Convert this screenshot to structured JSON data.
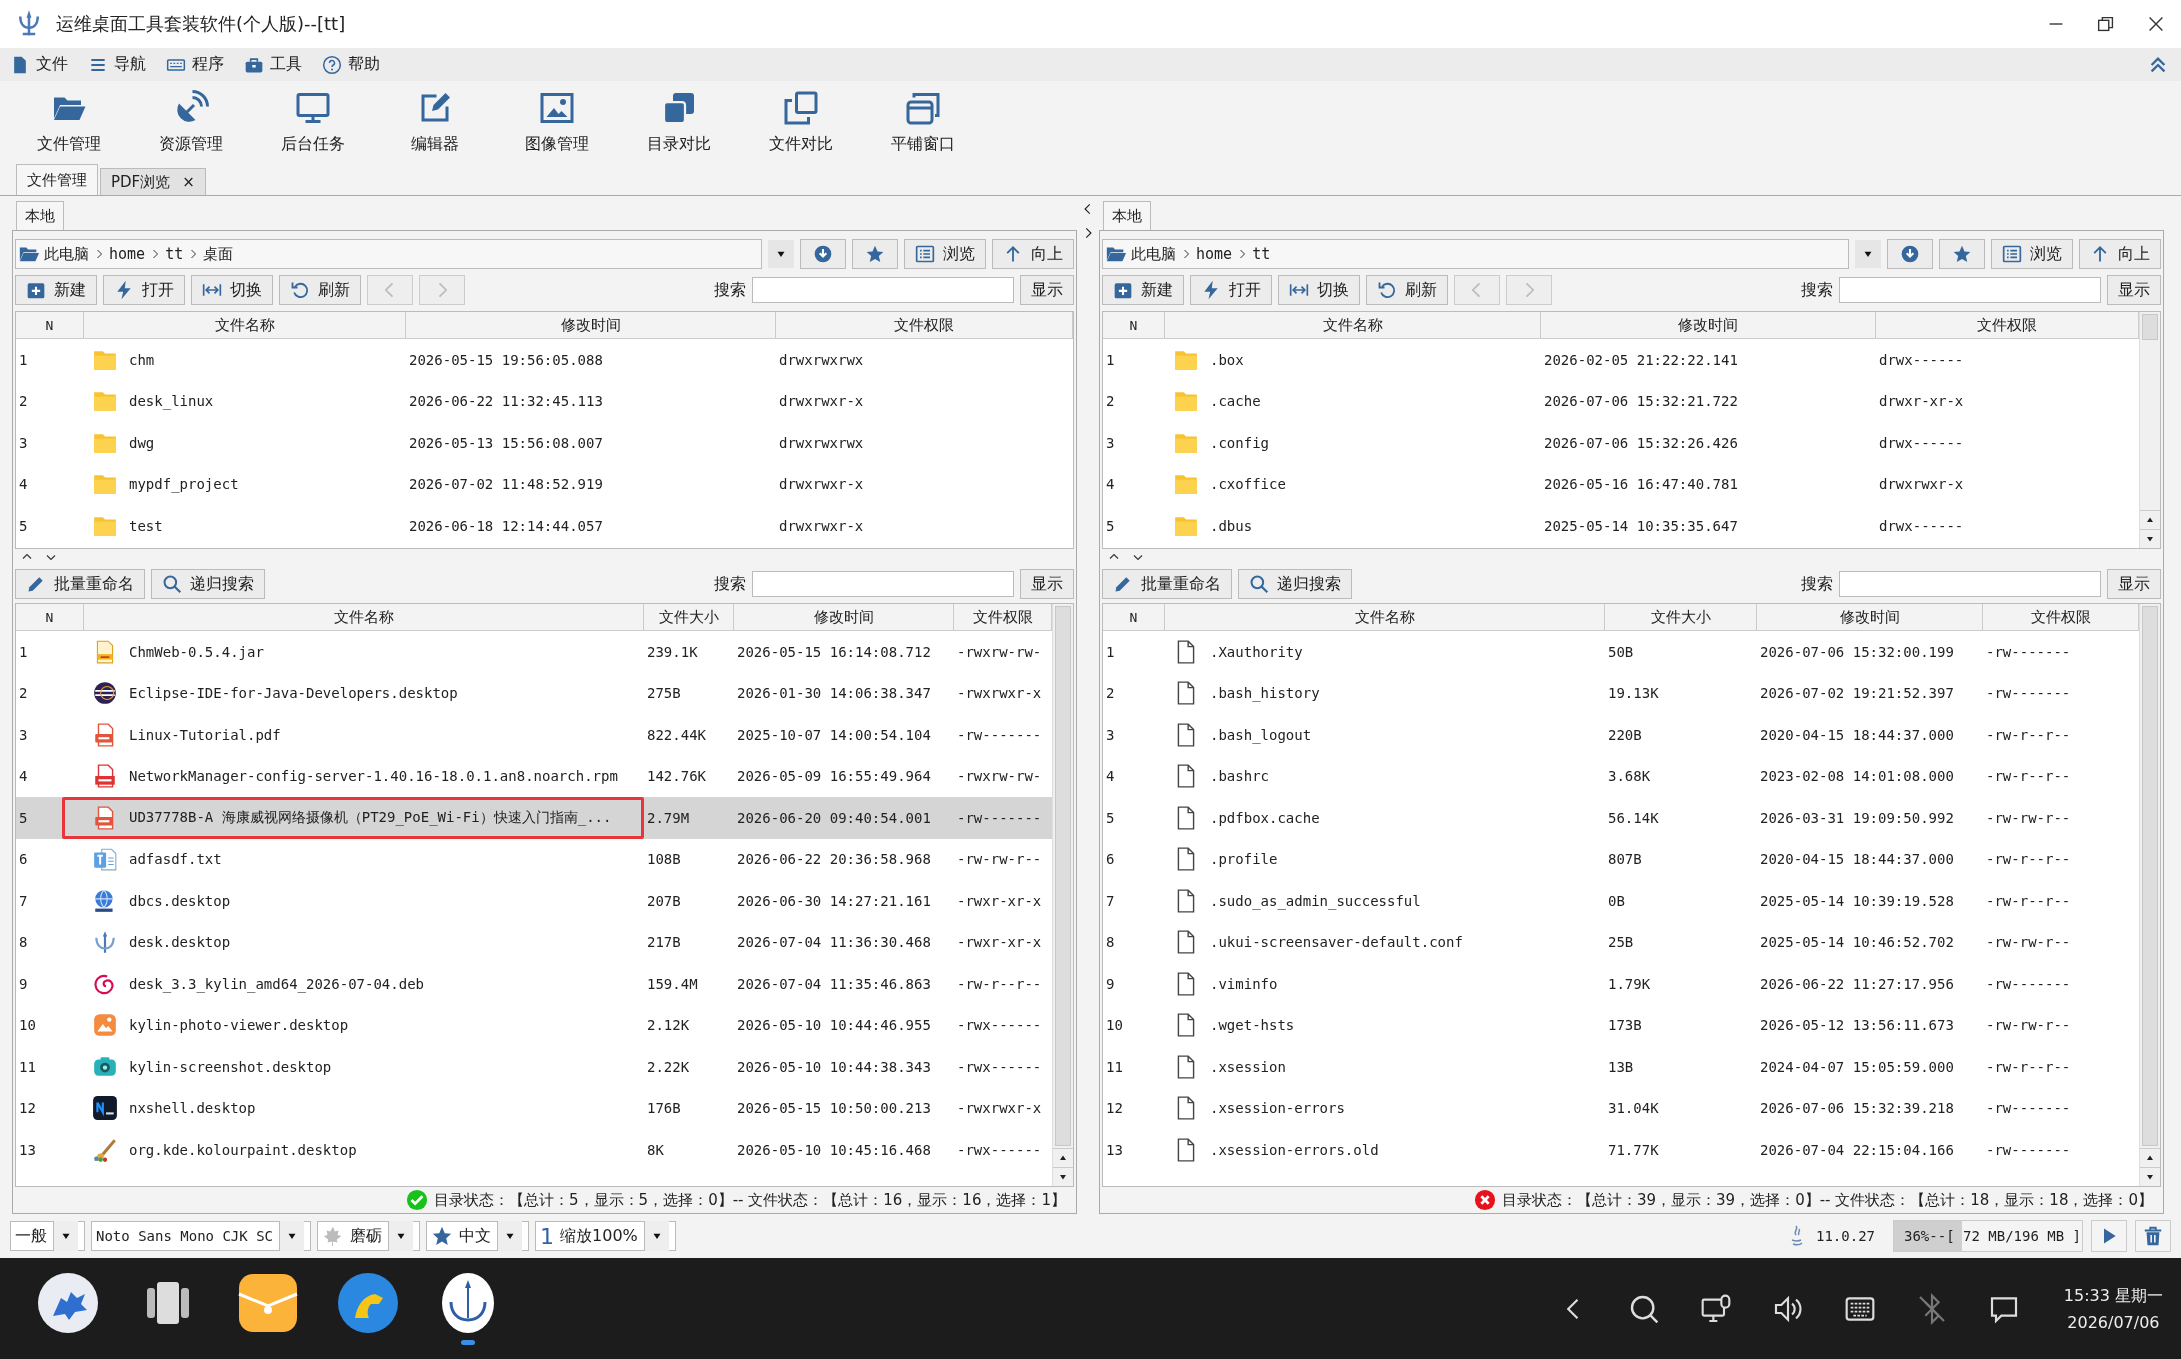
{
  "window": {
    "title": "运维桌面工具套装软件(个人版)--[tt]"
  },
  "menu": [
    {
      "label": "文件"
    },
    {
      "label": "导航"
    },
    {
      "label": "程序"
    },
    {
      "label": "工具"
    },
    {
      "label": "帮助"
    }
  ],
  "toolbar": [
    {
      "label": "文件管理"
    },
    {
      "label": "资源管理"
    },
    {
      "label": "后台任务"
    },
    {
      "label": "编辑器"
    },
    {
      "label": "图像管理"
    },
    {
      "label": "目录对比"
    },
    {
      "label": "文件对比"
    },
    {
      "label": "平铺窗口"
    }
  ],
  "tabs": [
    {
      "label": "文件管理",
      "selected": true
    },
    {
      "label": "PDF浏览",
      "selected": false,
      "close": "×"
    }
  ],
  "panels": [
    {
      "tab": "本地",
      "path": [
        "此电脑",
        "home",
        "tt",
        "桌面"
      ],
      "path_buttons": [
        "浏览",
        "向上"
      ],
      "actions": [
        "新建",
        "打开",
        "切换",
        "刷新"
      ],
      "nav": [
        {
          "disabled": true
        },
        {
          "disabled": true
        }
      ],
      "search_label": "搜索",
      "show_button": "显示",
      "dirs": {
        "columns": [
          "N",
          "文件名称",
          "修改时间",
          "文件权限"
        ],
        "rows": [
          {
            "n": "1",
            "name": "chm",
            "modified": "2026-05-15 19:56:05.088",
            "perm": "drwxrwxrwx"
          },
          {
            "n": "2",
            "name": "desk_linux",
            "modified": "2026-06-22 11:32:45.113",
            "perm": "drwxrwxr-x"
          },
          {
            "n": "3",
            "name": "dwg",
            "modified": "2026-05-13 15:56:08.007",
            "perm": "drwxrwxrwx"
          },
          {
            "n": "4",
            "name": "mypdf_project",
            "modified": "2026-07-02 11:48:52.919",
            "perm": "drwxrwxr-x"
          },
          {
            "n": "5",
            "name": "test",
            "modified": "2026-06-18 12:14:44.057",
            "perm": "drwxrwxr-x"
          }
        ]
      },
      "file_actions": [
        "批量重命名",
        "递归搜索"
      ],
      "file_search_label": "搜索",
      "file_show_button": "显示",
      "files": {
        "columns": [
          "N",
          "文件名称",
          "文件大小",
          "修改时间",
          "文件权限"
        ],
        "rows": [
          {
            "n": "1",
            "kind": "jar",
            "name": "ChmWeb-0.5.4.jar",
            "size": "239.1K",
            "modified": "2026-05-15 16:14:08.712",
            "perm": "-rwxrw-rw-",
            "selected": false,
            "outlined": false
          },
          {
            "n": "2",
            "kind": "app",
            "name": "Eclipse-IDE-for-Java-Developers.desktop",
            "size": "275B",
            "modified": "2026-01-30 14:06:38.347",
            "perm": "-rwxrwxr-x",
            "selected": false,
            "outlined": false
          },
          {
            "n": "3",
            "kind": "pdf",
            "name": "Linux-Tutorial.pdf",
            "size": "822.44K",
            "modified": "2025-10-07 14:00:54.104",
            "perm": "-rw-------",
            "selected": false,
            "outlined": false
          },
          {
            "n": "4",
            "kind": "rpm",
            "name": "NetworkManager-config-server-1.40.16-18.0.1.an8.noarch.rpm",
            "size": "142.76K",
            "modified": "2026-05-09 16:55:49.964",
            "perm": "-rwxrw-rw-",
            "selected": false,
            "outlined": false
          },
          {
            "n": "5",
            "kind": "pdf",
            "name": "UD37778B-A 海康威视网络摄像机（PT29_PoE_Wi-Fi）快速入门指南_...",
            "size": "2.79M",
            "modified": "2026-06-20 09:40:54.001",
            "perm": "-rw-------",
            "selected": true,
            "outlined": true
          },
          {
            "n": "6",
            "kind": "text",
            "name": "adfasdf.txt",
            "size": "108B",
            "modified": "2026-06-22 20:36:58.968",
            "perm": "-rw-rw-r--",
            "selected": false,
            "outlined": false
          },
          {
            "n": "7",
            "kind": "globe",
            "name": "dbcs.desktop",
            "size": "207B",
            "modified": "2026-06-30 14:27:21.161",
            "perm": "-rwxr-xr-x",
            "selected": false,
            "outlined": false
          },
          {
            "n": "8",
            "kind": "logo",
            "name": "desk.desktop",
            "size": "217B",
            "modified": "2026-07-04 11:36:30.468",
            "perm": "-rwxr-xr-x",
            "selected": false,
            "outlined": false
          },
          {
            "n": "9",
            "kind": "deb",
            "name": "desk_3.3_kylin_amd64_2026-07-04.deb",
            "size": "159.4M",
            "modified": "2026-07-04 11:35:46.863",
            "perm": "-rw-r--r--",
            "selected": false,
            "outlined": false
          },
          {
            "n": "10",
            "kind": "photo",
            "name": "kylin-photo-viewer.desktop",
            "size": "2.12K",
            "modified": "2026-05-10 10:44:46.955",
            "perm": "-rwx------",
            "selected": false,
            "outlined": false
          },
          {
            "n": "11",
            "kind": "camera",
            "name": "kylin-screenshot.desktop",
            "size": "2.22K",
            "modified": "2026-05-10 10:44:38.343",
            "perm": "-rwx------",
            "selected": false,
            "outlined": false
          },
          {
            "n": "12",
            "kind": "terminal",
            "name": "nxshell.desktop",
            "size": "176B",
            "modified": "2026-05-15 10:50:00.213",
            "perm": "-rwxrwxr-x",
            "selected": false,
            "outlined": false
          },
          {
            "n": "13",
            "kind": "paint",
            "name": "org.kde.kolourpaint.desktop",
            "size": "8K",
            "modified": "2026-05-10 10:45:16.468",
            "perm": "-rwx------",
            "selected": false,
            "outlined": false
          }
        ]
      },
      "status": {
        "ok": true,
        "text": "目录状态：【总计：5，显示：5，选择：0】-- 文件状态：【总计：16，显示：16，选择：1】"
      }
    },
    {
      "tab": "本地",
      "path": [
        "此电脑",
        "home",
        "tt"
      ],
      "path_buttons": [
        "浏览",
        "向上"
      ],
      "actions": [
        "新建",
        "打开",
        "切换",
        "刷新"
      ],
      "nav": [
        {
          "disabled": true
        },
        {
          "disabled": true
        }
      ],
      "search_label": "搜索",
      "show_button": "显示",
      "dirs": {
        "columns": [
          "N",
          "文件名称",
          "修改时间",
          "文件权限"
        ],
        "rows": [
          {
            "n": "1",
            "name": ".box",
            "modified": "2026-02-05 21:22:22.141",
            "perm": "drwx------"
          },
          {
            "n": "2",
            "name": ".cache",
            "modified": "2026-07-06 15:32:21.722",
            "perm": "drwxr-xr-x"
          },
          {
            "n": "3",
            "name": ".config",
            "modified": "2026-07-06 15:32:26.426",
            "perm": "drwx------"
          },
          {
            "n": "4",
            "name": ".cxoffice",
            "modified": "2026-05-16 16:47:40.781",
            "perm": "drwxrwxr-x"
          },
          {
            "n": "5",
            "name": ".dbus",
            "modified": "2025-05-14 10:35:35.647",
            "perm": "drwx------"
          }
        ]
      },
      "file_actions": [
        "批量重命名",
        "递归搜索"
      ],
      "file_search_label": "搜索",
      "file_show_button": "显示",
      "files": {
        "columns": [
          "N",
          "文件名称",
          "文件大小",
          "修改时间",
          "文件权限"
        ],
        "rows": [
          {
            "n": "1",
            "kind": "doc",
            "name": ".Xauthority",
            "size": "50B",
            "modified": "2026-07-06 15:32:00.199",
            "perm": "-rw-------",
            "selected": false,
            "outlined": false
          },
          {
            "n": "2",
            "kind": "doc",
            "name": ".bash_history",
            "size": "19.13K",
            "modified": "2026-07-02 19:21:52.397",
            "perm": "-rw-------",
            "selected": false,
            "outlined": false
          },
          {
            "n": "3",
            "kind": "doc",
            "name": ".bash_logout",
            "size": "220B",
            "modified": "2020-04-15 18:44:37.000",
            "perm": "-rw-r--r--",
            "selected": false,
            "outlined": false
          },
          {
            "n": "4",
            "kind": "doc",
            "name": ".bashrc",
            "size": "3.68K",
            "modified": "2023-02-08 14:01:08.000",
            "perm": "-rw-r--r--",
            "selected": false,
            "outlined": false
          },
          {
            "n": "5",
            "kind": "doc",
            "name": ".pdfbox.cache",
            "size": "56.14K",
            "modified": "2026-03-31 19:09:50.992",
            "perm": "-rw-rw-r--",
            "selected": false,
            "outlined": false
          },
          {
            "n": "6",
            "kind": "doc",
            "name": ".profile",
            "size": "807B",
            "modified": "2020-04-15 18:44:37.000",
            "perm": "-rw-r--r--",
            "selected": false,
            "outlined": false
          },
          {
            "n": "7",
            "kind": "doc",
            "name": ".sudo_as_admin_successful",
            "size": "0B",
            "modified": "2025-05-14 10:39:19.528",
            "perm": "-rw-r--r--",
            "selected": false,
            "outlined": false
          },
          {
            "n": "8",
            "kind": "doc",
            "name": ".ukui-screensaver-default.conf",
            "size": "25B",
            "modified": "2025-05-14 10:46:52.702",
            "perm": "-rw-rw-r--",
            "selected": false,
            "outlined": false
          },
          {
            "n": "9",
            "kind": "doc",
            "name": ".viminfo",
            "size": "1.79K",
            "modified": "2026-06-22 11:27:17.956",
            "perm": "-rw-------",
            "selected": false,
            "outlined": false
          },
          {
            "n": "10",
            "kind": "doc",
            "name": ".wget-hsts",
            "size": "173B",
            "modified": "2026-05-12 13:56:11.673",
            "perm": "-rw-rw-r--",
            "selected": false,
            "outlined": false
          },
          {
            "n": "11",
            "kind": "doc",
            "name": ".xsession",
            "size": "13B",
            "modified": "2024-04-07 15:05:59.000",
            "perm": "-rw-r--r--",
            "selected": false,
            "outlined": false
          },
          {
            "n": "12",
            "kind": "doc",
            "name": ".xsession-errors",
            "size": "31.04K",
            "modified": "2026-07-06 15:32:39.218",
            "perm": "-rw-------",
            "selected": false,
            "outlined": false
          },
          {
            "n": "13",
            "kind": "doc",
            "name": ".xsession-errors.old",
            "size": "71.77K",
            "modified": "2026-07-04 22:15:04.166",
            "perm": "-rw-------",
            "selected": false,
            "outlined": false
          }
        ]
      },
      "status": {
        "ok": false,
        "text": "目录状态：【总计：39，显示：39，选择：0】-- 文件状态：【总计：18，显示：18，选择：0】"
      }
    }
  ],
  "statusbar": {
    "combos": [
      {
        "value": "一般"
      },
      {
        "value": "Noto Sans Mono CJK SC"
      },
      {
        "value": "磨砺"
      },
      {
        "value": "中文"
      },
      {
        "prefix": "1",
        "value": "缩放100%"
      }
    ],
    "version": "11.0.27",
    "memory": {
      "text": "36%--[ 72 MB/196 MB ]",
      "level": 0.36
    }
  },
  "taskbar": {
    "apps": [
      {
        "active": false
      },
      {
        "active": false
      },
      {
        "active": false
      },
      {
        "active": false
      },
      {
        "active": true
      }
    ],
    "time": "15:33 星期一",
    "date": "2026/07/06"
  }
}
